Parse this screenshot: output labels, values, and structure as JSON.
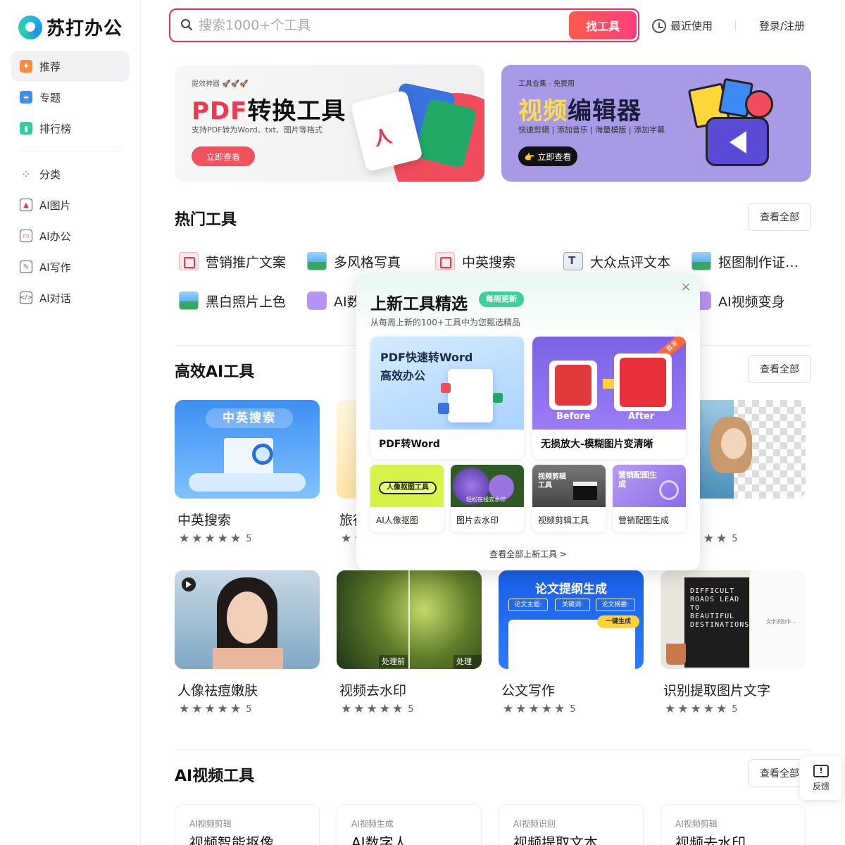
{
  "brand": {
    "name": "苏打办公"
  },
  "sidebar": {
    "items": [
      {
        "label": "推荐",
        "icon": "recommend-icon"
      },
      {
        "label": "专题",
        "icon": "topic-icon"
      },
      {
        "label": "排行榜",
        "icon": "ranking-icon"
      },
      {
        "label": "分类",
        "icon": "category-icon"
      },
      {
        "label": "AI图片",
        "icon": "ai-image-icon"
      },
      {
        "label": "AI办公",
        "icon": "ai-office-icon"
      },
      {
        "label": "AI写作",
        "icon": "ai-writing-icon"
      },
      {
        "label": "AI对话",
        "icon": "ai-chat-icon"
      }
    ]
  },
  "header": {
    "search_placeholder": "搜索1000+个工具",
    "search_button": "找工具",
    "recent": "最近使用",
    "login": "登录/注册"
  },
  "banners": [
    {
      "tag": "提效神器 🚀🚀🚀",
      "title_accent": "PDF",
      "title_rest": "转换工具",
      "desc": "支持PDF转为Word、txt、图片等格式",
      "button": "立即查看"
    },
    {
      "tag": "工具合集 - 免费用",
      "title_accent": "视频",
      "title_rest": "编辑器",
      "desc": "快速剪辑 | 添加音乐 | 海量模版 | 添加字幕",
      "button": "👉 立即查看"
    }
  ],
  "hot_tools": {
    "title": "热门工具",
    "view_all": "查看全部",
    "items": [
      {
        "label": "营销推广文案",
        "icon": "pdf-doc-icon"
      },
      {
        "label": "多风格写真",
        "icon": "image-icon"
      },
      {
        "label": "中英搜索",
        "icon": "pdf-doc-icon"
      },
      {
        "label": "大众点评文本",
        "icon": "text-doc-icon"
      },
      {
        "label": "抠图制作证…",
        "icon": "image-icon"
      },
      {
        "label": "黑白照片上色",
        "icon": "image-icon"
      },
      {
        "label": "AI数",
        "icon": "video-doc-icon"
      },
      {
        "label": "AI视频变身",
        "icon": "video-doc-icon"
      }
    ]
  },
  "ai_tools": {
    "title": "高效AI工具",
    "view_all": "查看全部",
    "cards": [
      {
        "name": "中英搜索",
        "rating": "5",
        "thumb_text": "中英搜索"
      },
      {
        "name": "旅行",
        "rating": "5",
        "thumb_text": ""
      },
      {
        "name": "",
        "rating": "",
        "thumb_text": ""
      },
      {
        "name": "抠图",
        "rating": "5",
        "thumb_text": ""
      },
      {
        "name": "人像祛痘嫩肤",
        "rating": "5",
        "thumb_text": ""
      },
      {
        "name": "视频去水印",
        "rating": "5",
        "thumb_text": "处理前"
      },
      {
        "name": "公文写作",
        "rating": "5",
        "thumb_text": "论文提纲生成"
      },
      {
        "name": "识别提取图片文字",
        "rating": "5",
        "thumb_text": "DIFFICULT ROADS LEAD TO BEAUTIFUL DESTINATIONS"
      }
    ],
    "stars": "★★★★★"
  },
  "ai_video": {
    "title": "AI视频工具",
    "view_all": "查看全部",
    "cards": [
      {
        "category": "AI视频剪辑",
        "name": "视频智能抠像"
      },
      {
        "category": "AI视频生成",
        "name": "AI数字人"
      },
      {
        "category": "AI视频识别",
        "name": "视频提取文本"
      },
      {
        "category": "AI视频剪辑",
        "name": "视频去水印"
      }
    ]
  },
  "popup": {
    "title": "上新工具精选",
    "badge": "每周更新",
    "subtitle": "从每周上新的100+工具中为您甄选精品",
    "big": [
      {
        "label": "PDF转Word",
        "thumb_line1": "PDF快速转Word",
        "thumb_line2": "高效办公"
      },
      {
        "label": "无损放大-模糊图片变清晰",
        "before": "Before",
        "after": "After",
        "ribbon": "首发"
      }
    ],
    "small": [
      {
        "label": "AI人像抠图",
        "thumb": "人像抠图工具"
      },
      {
        "label": "图片去水印",
        "thumb": "轻松在线去水印"
      },
      {
        "label": "视频剪辑工具",
        "thumb": "视频剪辑工具"
      },
      {
        "label": "营销配图生成",
        "thumb": "营销配图生成"
      }
    ],
    "more": "查看全部上新工具 >"
  },
  "feedback": {
    "label": "反馈"
  }
}
